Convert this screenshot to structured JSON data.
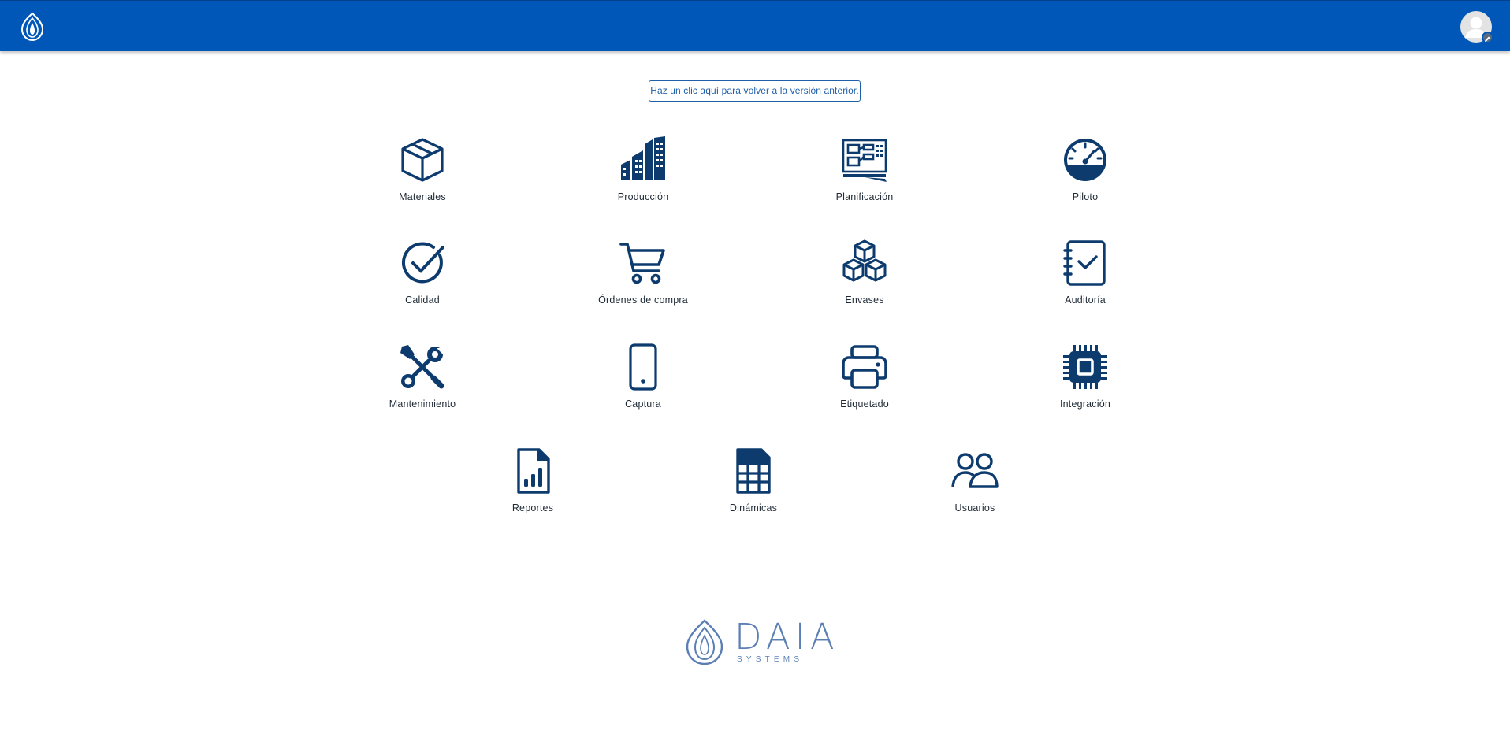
{
  "header": {
    "logo_icon": "daia-leaf-icon",
    "avatar_icon": "user-avatar-icon",
    "avatar_edit_icon": "pencil-icon",
    "bar_color": "#0057b8"
  },
  "legacy_link": {
    "label": "Haz un clic aquí para volver a la versión anterior."
  },
  "modules": [
    {
      "label": "Materiales",
      "icon": "box-icon"
    },
    {
      "label": "Producción",
      "icon": "factory-building-icon"
    },
    {
      "label": "Planificación",
      "icon": "planning-board-icon"
    },
    {
      "label": "Piloto",
      "icon": "speedometer-icon"
    },
    {
      "label": "Calidad",
      "icon": "check-circle-icon"
    },
    {
      "label": "Órdenes de compra",
      "icon": "shopping-cart-icon"
    },
    {
      "label": "Envases",
      "icon": "stacked-cubes-icon"
    },
    {
      "label": "Auditoría",
      "icon": "checklist-notebook-icon"
    },
    {
      "label": "Mantenimiento",
      "icon": "tools-icon"
    },
    {
      "label": "Captura",
      "icon": "mobile-phone-icon"
    },
    {
      "label": "Etiquetado",
      "icon": "printer-icon"
    },
    {
      "label": "Integración",
      "icon": "chip-icon"
    },
    {
      "label": "Reportes",
      "icon": "report-chart-icon"
    },
    {
      "label": "Dinámicas",
      "icon": "spreadsheet-icon"
    },
    {
      "label": "Usuarios",
      "icon": "users-icon"
    }
  ],
  "footer": {
    "brand": "DAIA",
    "tagline": "SYSTEMS",
    "logo_icon": "daia-leaf-icon"
  },
  "colors": {
    "icon": "#0d3b6e",
    "text": "#1f2a36",
    "brand_light": "#5b7fb4"
  }
}
